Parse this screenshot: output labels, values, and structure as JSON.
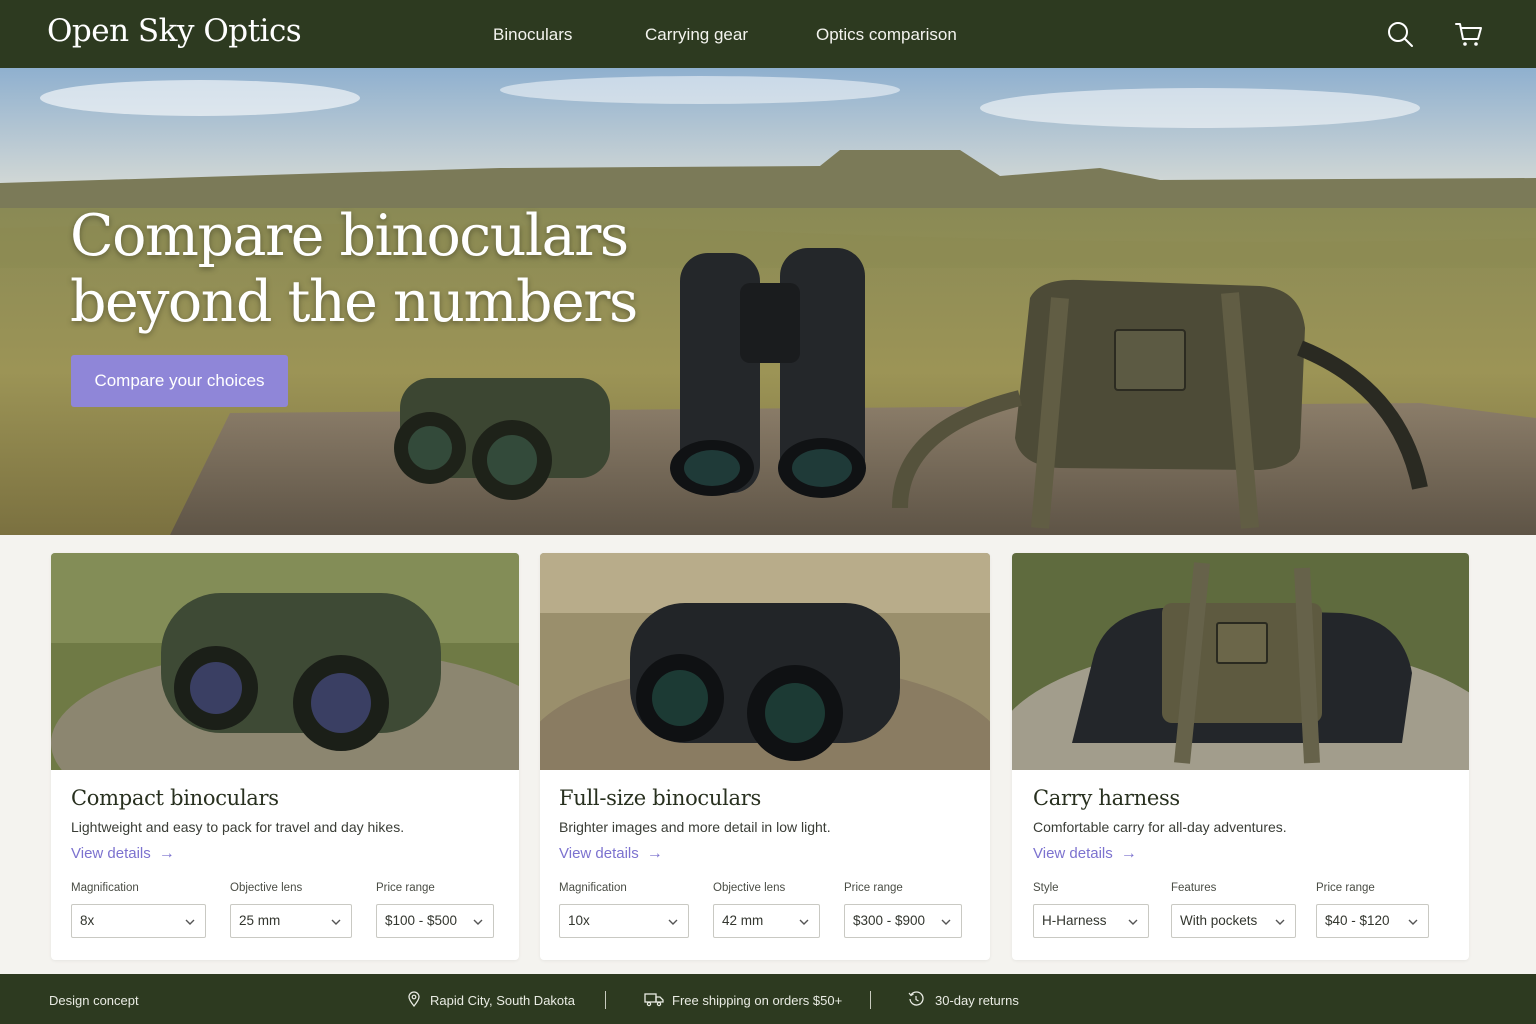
{
  "header": {
    "brand": "Open Sky Optics",
    "nav": [
      "Binoculars",
      "Carrying gear",
      "Optics comparison"
    ],
    "icons": [
      "search-icon",
      "cart-icon"
    ]
  },
  "hero": {
    "title_line1": "Compare binoculars",
    "title_line2": "beyond the numbers",
    "cta": "Compare your choices"
  },
  "cards": [
    {
      "title": "Compact binoculars",
      "desc": "Lightweight and easy to pack for travel and day hikes.",
      "link": "View details",
      "filters": [
        {
          "label": "Magnification",
          "value": "8x"
        },
        {
          "label": "Objective lens",
          "value": "25 mm"
        },
        {
          "label": "Price range",
          "value": "$100 - $500"
        }
      ]
    },
    {
      "title": "Full-size binoculars",
      "desc": "Brighter images and more detail in low light.",
      "link": "View details",
      "filters": [
        {
          "label": "Magnification",
          "value": "10x"
        },
        {
          "label": "Objective lens",
          "value": "42 mm"
        },
        {
          "label": "Price range",
          "value": "$300 - $900"
        }
      ]
    },
    {
      "title": "Carry harness",
      "desc": "Comfortable carry for all-day adventures.",
      "link": "View details",
      "filters": [
        {
          "label": "Style",
          "value": "H-Harness"
        },
        {
          "label": "Features",
          "value": "With pockets"
        },
        {
          "label": "Price range",
          "value": "$40 - $120"
        }
      ]
    }
  ],
  "footer": {
    "left": "Design concept",
    "location": "Rapid City, South Dakota",
    "shipping": "Free shipping on orders $50+",
    "returns": "30-day returns"
  },
  "colors": {
    "header_bg": "#2d3a20",
    "accent": "#8f86d8",
    "link": "#7c72cf",
    "page_bg": "#f4f3ef"
  }
}
